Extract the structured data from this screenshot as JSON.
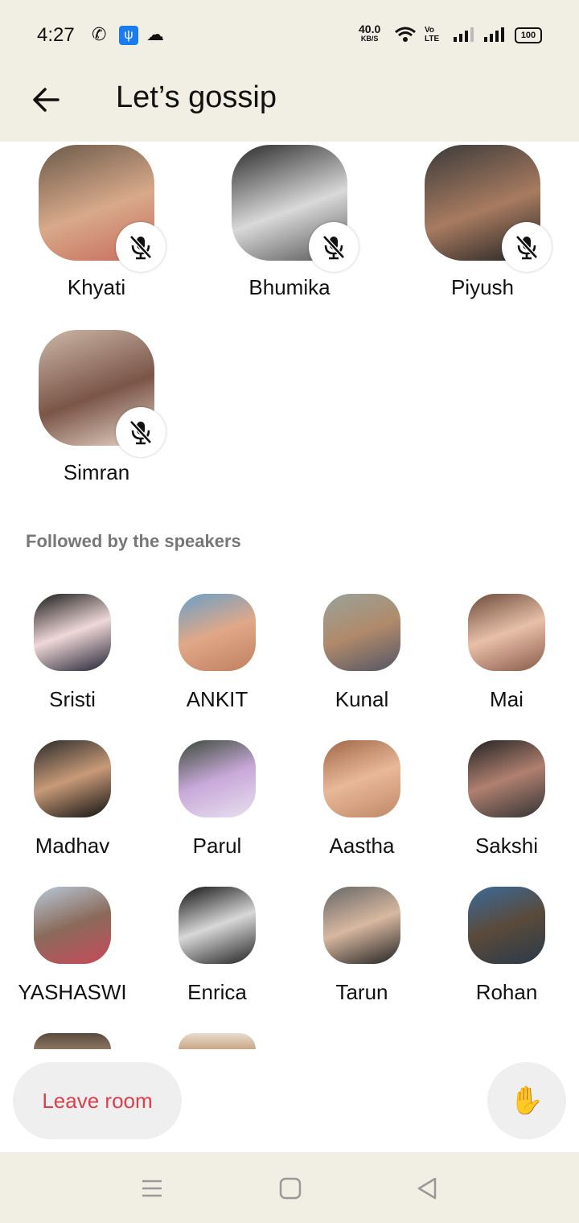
{
  "status_bar": {
    "time": "4:27",
    "speed_value": "40.0",
    "speed_unit": "KB/S",
    "network_label": "Vo LTE",
    "battery": "100"
  },
  "header": {
    "title": "Let’s gossip"
  },
  "speakers": [
    {
      "name": "Khyati",
      "muted": true
    },
    {
      "name": "Bhumika",
      "muted": true
    },
    {
      "name": "Piyush",
      "muted": true
    },
    {
      "name": "Simran",
      "muted": true
    }
  ],
  "section_label": "Followed by the speakers",
  "listeners": [
    {
      "name": "Sristi"
    },
    {
      "name": "ANKIT"
    },
    {
      "name": "Kunal"
    },
    {
      "name": "Mai"
    },
    {
      "name": "Madhav"
    },
    {
      "name": "Parul"
    },
    {
      "name": "Aastha"
    },
    {
      "name": "Sakshi"
    },
    {
      "name": "YASHASWI"
    },
    {
      "name": "Enrica"
    },
    {
      "name": "Tarun"
    },
    {
      "name": "Rohan"
    }
  ],
  "actions": {
    "leave_label": "Leave room",
    "hand_icon": "✋"
  },
  "colors": {
    "chrome_bg": "#f1eee3",
    "leave_text": "#d8404e"
  }
}
